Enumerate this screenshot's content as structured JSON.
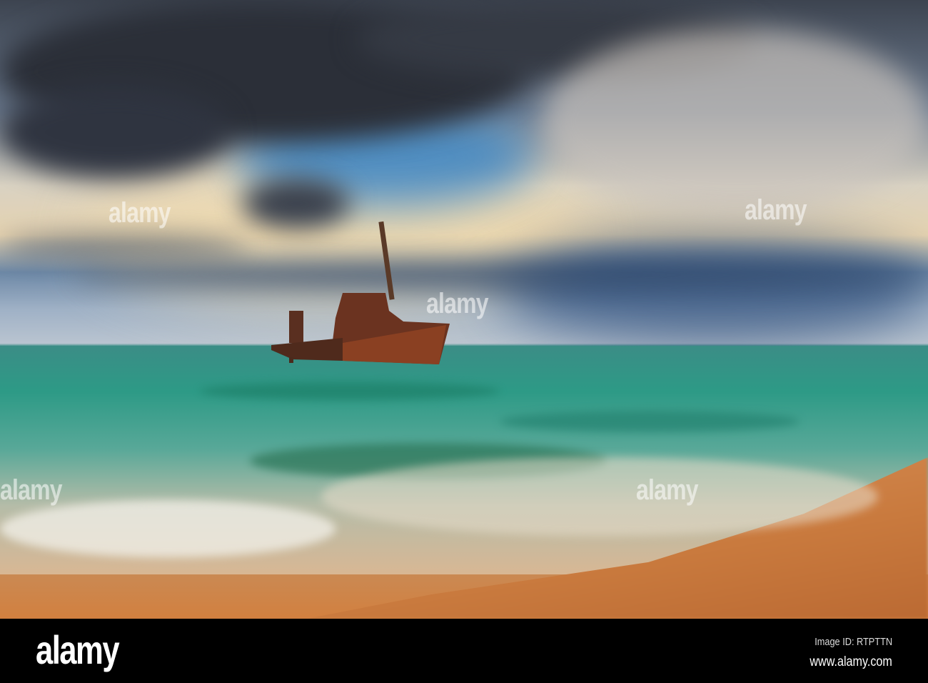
{
  "photo": {
    "subject": "Rusted shipwreck at beach under stormy sky"
  },
  "watermark": {
    "text": "alamy"
  },
  "footer": {
    "logo": "alamy",
    "image_id": "Image ID: RTPTTN",
    "url": "www.alamy.com"
  }
}
